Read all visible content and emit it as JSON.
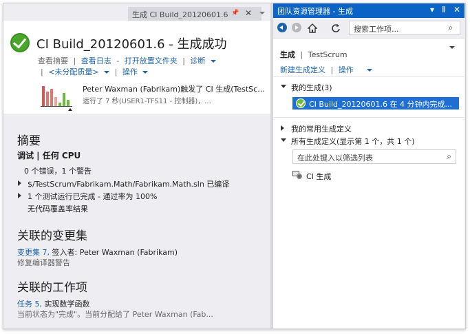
{
  "left": {
    "tab": {
      "title": "生成 CI Build_20120601.6",
      "pin": "📌",
      "close": "✕"
    },
    "header": {
      "title": "CI Build_20120601.6 - 生成成功",
      "actions_line1": [
        "查看摘要",
        "查看日志",
        "打开放置文件夹",
        "诊断"
      ],
      "actions_line2": [
        "<未分配质量>",
        "操作"
      ],
      "trigger_text": "Peter Waxman (Fabrikam)触发了 CI 生成(TestSc...",
      "run_text": "运行了 7 秒(USER1-TFS11 - 控制器)，..."
    },
    "summary": {
      "title": "摘要",
      "config": "调试 | 任何 CPU",
      "errors": "0 个错误，1 个警告",
      "compile_text": "$/TestScrum/Fabrikam.Math/Fabrikam.Math.sln 已编译",
      "test_text": "1 个测试运行已完成 - 通过率为 100%",
      "coverage_text": "无代码覆盖率结果"
    },
    "changesets": {
      "title": "关联的变更集",
      "link": "变更集 7,",
      "checked_in": " 签入者: Peter Waxman (Fabrikam)",
      "comment": "修复编译器警告"
    },
    "workitems": {
      "title": "关联的工作项",
      "link": "任务 5,",
      "name": " 实现数学函数",
      "status": "当前状态为\"完成\"。当前分配给了 Peter Waxman (Fab..."
    }
  },
  "right": {
    "title": "团队资源管理器 - 生成",
    "title_controls": [
      "▾",
      "Ⅱ",
      "✕"
    ],
    "toolbar": {
      "search_placeholder": "搜索工作项...",
      "search_icon": "⌕"
    },
    "panel": {
      "heading": "生成",
      "project": "TestScrum",
      "links": [
        "新建生成定义",
        "操作"
      ]
    },
    "my_builds": {
      "label": "我的生成(3)",
      "selected_item": "CI Build_20120601.6 在 4 分钟内完成..."
    },
    "favorites": {
      "label": "我的常用生成定义"
    },
    "all_defs": {
      "label": "所有生成定义(显示第 1 个，共 1 个)",
      "filter_placeholder": "在此处键入以筛选列表",
      "filter_icon": "⌕",
      "item": "CI 生成"
    }
  }
}
